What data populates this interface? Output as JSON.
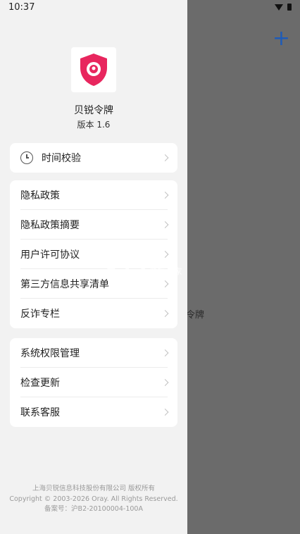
{
  "status_bar": {
    "time": "10:37"
  },
  "background_app": {
    "visible_text": "令牌"
  },
  "drawer": {
    "app_name": "贝锐令牌",
    "version": "版本 1.6",
    "menu_groups": [
      [
        "时间校验"
      ],
      [
        "隐私政策",
        "隐私政策摘要",
        "用户许可协议",
        "第三方信息共享清单",
        "反诈专栏"
      ],
      [
        "系统权限管理",
        "检查更新",
        "联系客服"
      ]
    ],
    "footer": {
      "company": "上海贝锐信息科技股份有限公司 版权所有",
      "copyright": "Copyright © 2003-2026 Oray. All Rights Reserved.",
      "icp": "备案号：沪B2-20100004-100A"
    }
  },
  "watermark": {
    "brand": "K73",
    "sub": "游戏之家"
  },
  "colors": {
    "logo_primary": "#e8265e",
    "fab_plus": "#1e5bb8"
  }
}
